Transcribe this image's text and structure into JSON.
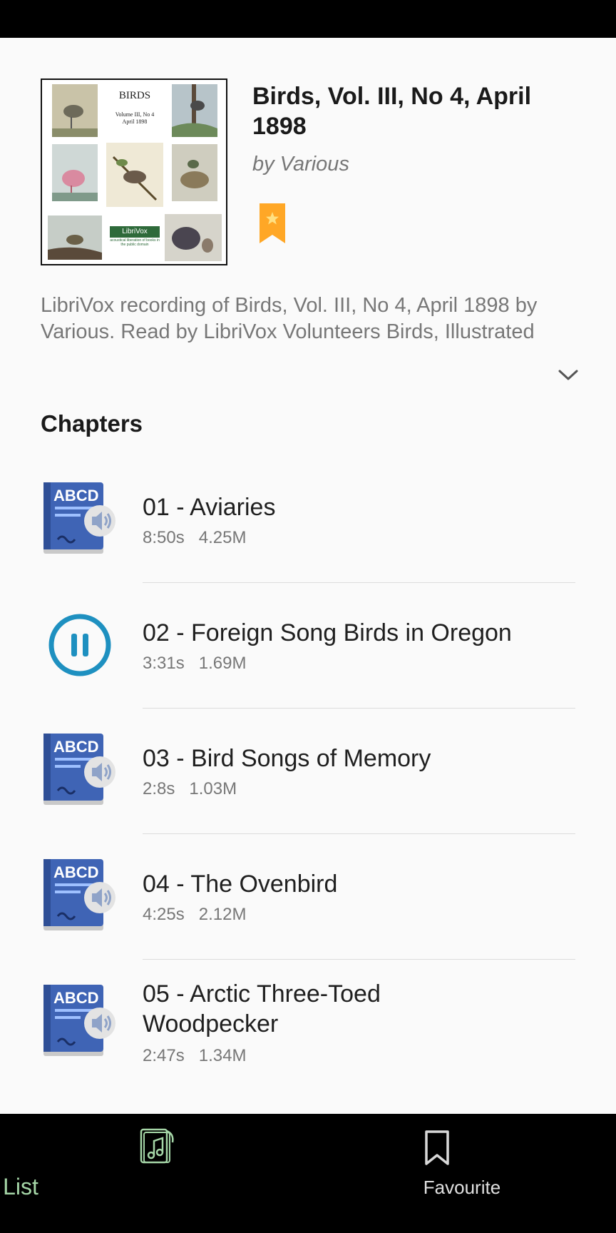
{
  "book": {
    "title": "Birds, Vol. III, No 4, April 1898",
    "author": "by Various",
    "description": "LibriVox recording of Birds, Vol. III, No 4, April 1898 by Various. Read by LibriVox Volunteers Birds, Illustrated",
    "cover": {
      "title": "BIRDS",
      "subtitle_line1": "Volume III, No 4",
      "subtitle_line2": "April 1898",
      "logo": "LibriVox",
      "logo_sub": "acoustical liberation of books in the public domain"
    }
  },
  "icons": {
    "favourite_badge": "bookmark-star-icon",
    "expand": "chevron-down-icon",
    "chapter_audiobook": "audiobook-icon",
    "chapter_playing": "pause-icon",
    "nav_list": "music-list-icon",
    "nav_favourite": "bookmark-icon"
  },
  "colors": {
    "accent_orange": "#ffa726",
    "accent_blue": "#1e90c0",
    "nav_active": "#a5d6a7",
    "book_blue": "#3f64b5"
  },
  "chapters_section": {
    "heading": "Chapters",
    "items": [
      {
        "title": "01 - Aviaries",
        "duration": "8:50s",
        "size": "4.25M",
        "playing": false
      },
      {
        "title": "02 - Foreign Song Birds in Oregon",
        "duration": "3:31s",
        "size": "1.69M",
        "playing": true
      },
      {
        "title": "03 - Bird Songs of Memory",
        "duration": "2:8s",
        "size": "1.03M",
        "playing": false
      },
      {
        "title": "04 - The Ovenbird",
        "duration": "4:25s",
        "size": "2.12M",
        "playing": false
      },
      {
        "title": "05 - Arctic Three-Toed Woodpecker",
        "duration": "2:47s",
        "size": "1.34M",
        "playing": false
      }
    ]
  },
  "bottom_nav": {
    "items": [
      {
        "label": "List",
        "active": true
      },
      {
        "label": "Favourite",
        "active": false
      }
    ]
  }
}
